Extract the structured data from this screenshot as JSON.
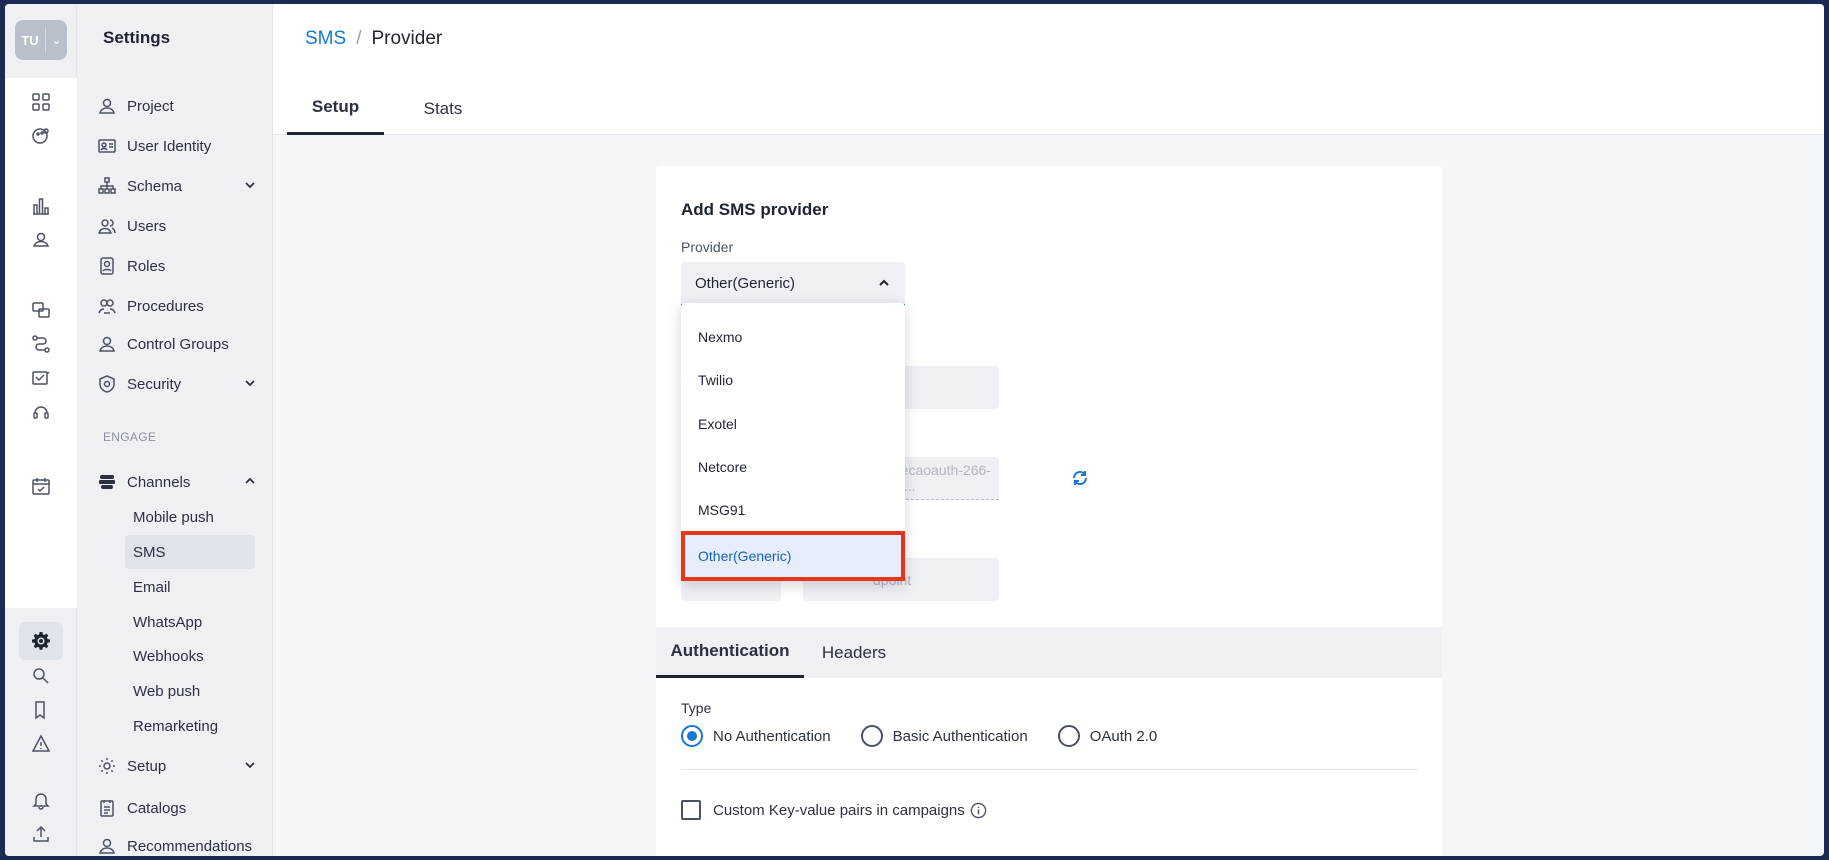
{
  "rail": {
    "initials": "TU"
  },
  "sidebar": {
    "title": "Settings",
    "items": [
      {
        "label": "Project"
      },
      {
        "label": "User Identity"
      },
      {
        "label": "Schema"
      },
      {
        "label": "Users"
      },
      {
        "label": "Roles"
      },
      {
        "label": "Procedures"
      },
      {
        "label": "Control Groups"
      },
      {
        "label": "Security"
      }
    ],
    "section_engage": "ENGAGE",
    "channels_label": "Channels",
    "channels": [
      {
        "label": "Mobile push"
      },
      {
        "label": "SMS"
      },
      {
        "label": "Email"
      },
      {
        "label": "WhatsApp"
      },
      {
        "label": "Webhooks"
      },
      {
        "label": "Web push"
      },
      {
        "label": "Remarketing"
      }
    ],
    "bottom": [
      {
        "label": "Setup"
      },
      {
        "label": "Catalogs"
      },
      {
        "label": "Recommendations"
      }
    ]
  },
  "breadcrumb": {
    "parent": "SMS",
    "separator": "/",
    "current": "Provider"
  },
  "tabs": [
    {
      "label": "Setup"
    },
    {
      "label": "Stats"
    }
  ],
  "form": {
    "title": "Add SMS provider",
    "provider_label": "Provider",
    "provider_value": "Other(Generic)",
    "masked_field_text": "recaoauth-266-d...",
    "endpoint_placeholder": "dpoint"
  },
  "dropdown": {
    "options": [
      {
        "label": "Nexmo"
      },
      {
        "label": "Twilio"
      },
      {
        "label": "Exotel"
      },
      {
        "label": "Netcore"
      },
      {
        "label": "MSG91"
      },
      {
        "label": "Other(Generic)"
      }
    ],
    "selected": "Other(Generic)"
  },
  "subtabs": [
    {
      "label": "Authentication"
    },
    {
      "label": "Headers"
    }
  ],
  "auth": {
    "type_label": "Type",
    "options": [
      {
        "label": "No Authentication"
      },
      {
        "label": "Basic Authentication"
      },
      {
        "label": "OAuth 2.0"
      }
    ],
    "selected": "No Authentication"
  },
  "custom_kv_label": "Custom Key-value pairs in campaigns",
  "colors": {
    "accent": "#1478d4",
    "highlight": "#e8361c",
    "frame": "#1c2a54"
  }
}
